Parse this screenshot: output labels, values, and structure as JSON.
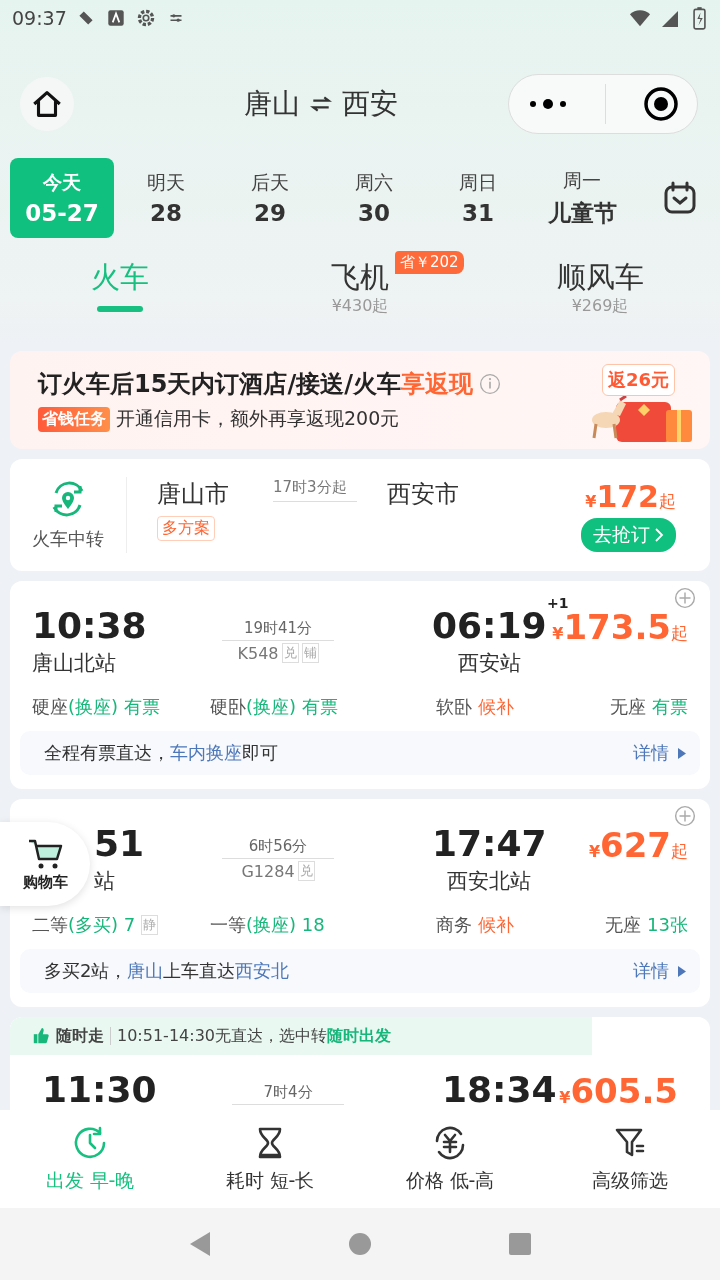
{
  "status_bar": {
    "time": "09:37"
  },
  "header": {
    "from": "唐山",
    "to": "西安"
  },
  "dates": [
    {
      "weekday": "今天",
      "date": "05-27",
      "selected": true
    },
    {
      "weekday": "明天",
      "date": "28",
      "selected": false
    },
    {
      "weekday": "后天",
      "date": "29",
      "selected": false
    },
    {
      "weekday": "周六",
      "date": "30",
      "selected": false
    },
    {
      "weekday": "周日",
      "date": "31",
      "selected": false
    },
    {
      "weekday": "周一",
      "date": "儿童节",
      "selected": false
    }
  ],
  "modes": [
    {
      "label": "火车",
      "selected": true
    },
    {
      "label": "飞机",
      "price": "¥430起",
      "badge": "省￥202",
      "selected": false
    },
    {
      "label": "顺风车",
      "price": "¥269起",
      "selected": false
    }
  ],
  "promo": {
    "title": [
      {
        "text": "订火车后15天内订酒店/接送/火车",
        "highlight": false
      },
      {
        "text": "享返现",
        "highlight": true
      }
    ],
    "tag": "省钱任务",
    "text": "开通信用卡，额外再享返现200元",
    "badge": "返26元"
  },
  "transfer": {
    "label": "火车中转",
    "from": "唐山市",
    "tag": "多方案",
    "duration": "17时3分起",
    "to": "西安市",
    "currency": "¥",
    "price": "172",
    "suffix": "起",
    "button": "去抢订"
  },
  "trains": [
    {
      "covered": false,
      "dep_time": "10:38",
      "dep_station": "唐山北站",
      "duration": "19时41分",
      "train_no": "K548",
      "train_tags": [
        "兑",
        "铺"
      ],
      "arr_time": "06:19",
      "day_offset": "+1",
      "arr_station": "西安站",
      "currency": "¥",
      "price": "173.5",
      "suffix": "起",
      "seats": [
        {
          "name": "硬座",
          "note": "(换座)",
          "status": "有票",
          "kind": "available"
        },
        {
          "name": "硬卧",
          "note": "(换座)",
          "status": "有票",
          "kind": "available"
        },
        {
          "name": "软卧",
          "status": "候补",
          "kind": "waitlist"
        },
        {
          "name": "无座",
          "status": "有票",
          "kind": "available"
        }
      ],
      "info": [
        {
          "text": "全程有票直达，",
          "highlight": false
        },
        {
          "text": "车内换座",
          "highlight": true
        },
        {
          "text": "即可",
          "highlight": false
        }
      ],
      "details": "详情"
    },
    {
      "covered": true,
      "dep_time": "51",
      "dep_station": "站",
      "duration": "6时56分",
      "train_no": "G1284",
      "train_tags": [
        "兑"
      ],
      "arr_time": "17:47",
      "arr_station": "西安北站",
      "currency": "¥",
      "price": "627",
      "suffix": "起",
      "seats": [
        {
          "name": "二等",
          "note": "(多买)",
          "status": "7",
          "tag": "静",
          "kind": "available"
        },
        {
          "name": "一等",
          "note": "(换座)",
          "status": "18",
          "kind": "available"
        },
        {
          "name": "商务",
          "status": "候补",
          "kind": "waitlist"
        },
        {
          "name": "无座",
          "status": "13张",
          "kind": "available"
        }
      ],
      "info": [
        {
          "text": "多买2站，",
          "highlight": false
        },
        {
          "text": "唐山",
          "highlight": true
        },
        {
          "text": "上车直达",
          "highlight": false
        },
        {
          "text": "西安北",
          "highlight": true
        }
      ],
      "details": "详情"
    }
  ],
  "tip_card": {
    "label": "随时走",
    "text": [
      {
        "text": "10:51-14:30无直达，选中转",
        "highlight": false
      },
      {
        "text": "随时出发",
        "highlight": true
      }
    ],
    "dep_time": "11:30",
    "duration": "7时4分",
    "arr_time": "18:34",
    "currency": "¥",
    "price": "605.5"
  },
  "cart": {
    "label": "购物车"
  },
  "sort_bar": [
    {
      "label": "出发 早-晚",
      "selected": true
    },
    {
      "label": "耗时 短-长",
      "selected": false
    },
    {
      "label": "价格 低-高",
      "selected": false
    },
    {
      "label": "高级筛选",
      "selected": false
    }
  ]
}
